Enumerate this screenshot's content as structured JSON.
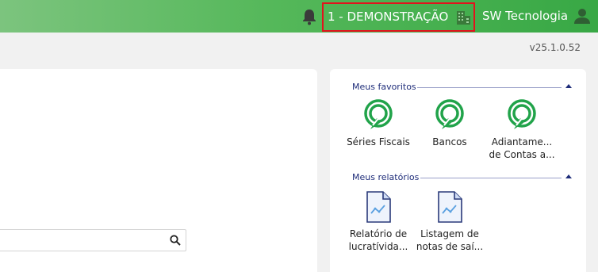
{
  "header": {
    "company": "1 - DEMONSTRAÇÃO",
    "user": "SW Tecnologia"
  },
  "version": "v25.1.0.52",
  "favorites": {
    "title": "Meus favoritos",
    "items": [
      {
        "line1": "Séries Fiscais",
        "line2": ""
      },
      {
        "line1": "Bancos",
        "line2": ""
      },
      {
        "line1": "Adiantame...",
        "line2": "de Contas a..."
      }
    ]
  },
  "reports": {
    "title": "Meus relatórios",
    "items": [
      {
        "line1": "Relatório de",
        "line2": "lucratívida..."
      },
      {
        "line1": "Listagem de",
        "line2": "notas de saí..."
      }
    ]
  },
  "colors": {
    "header_green": "#38a845",
    "highlight_red": "#e3121d",
    "accent_navy": "#1f2d7a"
  }
}
